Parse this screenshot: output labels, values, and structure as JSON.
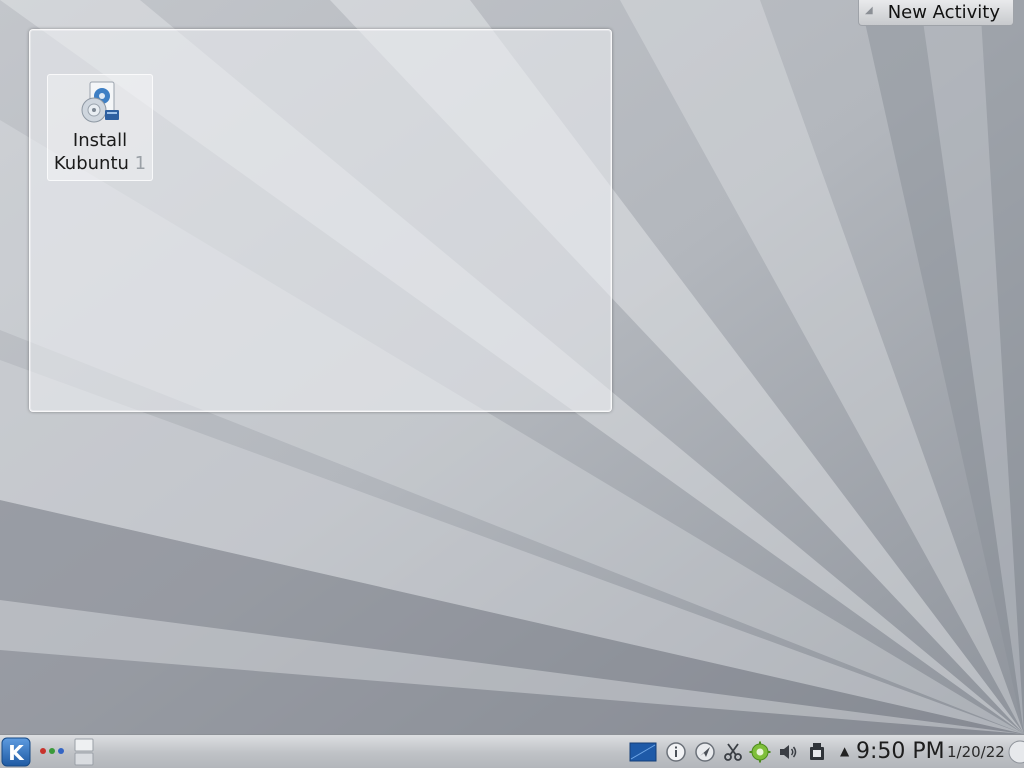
{
  "desktop": {
    "icons": [
      {
        "label_line1": "Install",
        "label_line2": "Kubuntu",
        "label_faded": " 1",
        "icon": "installer-disc-icon"
      }
    ]
  },
  "activity": {
    "new_activity_label": "New Activity"
  },
  "panel": {
    "kickoff_icon": "kde-k-menu-icon",
    "activity_manager_icon": "activity-dots-icon",
    "pager_icon": "virtual-desktop-pager-icon",
    "tray_icons": [
      "screen-icon",
      "info-icon",
      "network-icon",
      "clipboard-scissors-icon",
      "update-notifier-icon",
      "volume-icon",
      "device-notifier-icon"
    ],
    "tray_expander_icon": "up-arrow-icon",
    "clock_time": "9:50 PM",
    "clock_date": "1/20/22",
    "cashew_icon": "panel-toolbox-icon"
  },
  "colors": {
    "panel": "#c3c6ca",
    "kickoff_blue": "#2f6fb6",
    "wallpaper_base": "#b4b8be"
  }
}
